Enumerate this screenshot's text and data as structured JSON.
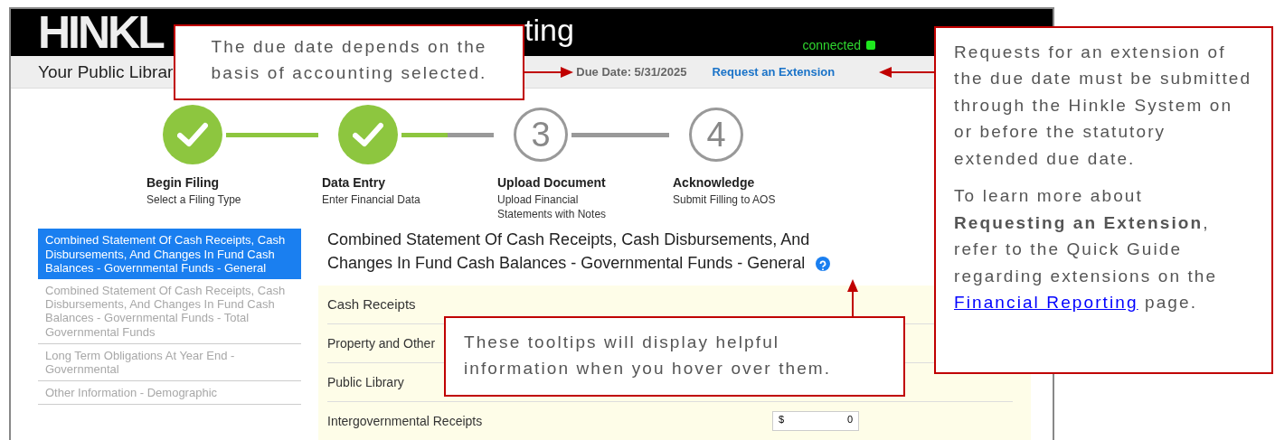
{
  "header": {
    "logo": "HINKL",
    "title": "ting",
    "status": "connected"
  },
  "subheader": {
    "library": "Your Public Librar",
    "due_date": "Due Date: 5/31/2025",
    "extension_link": "Request an Extension"
  },
  "steps": [
    {
      "title": "Begin Filing",
      "subtitle": "Select a Filing Type",
      "done": true
    },
    {
      "title": "Data Entry",
      "subtitle": "Enter Financial Data",
      "done": true
    },
    {
      "number": "3",
      "title": "Upload Document",
      "subtitle": "Upload Financial Statements with Notes",
      "done": false
    },
    {
      "number": "4",
      "title": "Acknowledge",
      "subtitle": "Submit Filling to AOS",
      "done": false
    }
  ],
  "sidebar": {
    "items": [
      {
        "label": "Combined Statement Of Cash Receipts, Cash Disbursements, And Changes In Fund Cash Balances - Governmental Funds - General",
        "selected": true,
        "disabled": false
      },
      {
        "label": "Combined Statement Of Cash Receipts, Cash Disbursements, And Changes In Fund Cash Balances - Governmental Funds - Total Governmental Funds",
        "selected": false,
        "disabled": true
      },
      {
        "label": "Long Term Obligations At Year End - Governmental",
        "selected": false,
        "disabled": true
      },
      {
        "label": "Other Information - Demographic",
        "selected": false,
        "disabled": true
      }
    ]
  },
  "section": {
    "title": "Combined Statement Of Cash Receipts, Cash Disbursements, And Changes In Fund Cash Balances - Governmental Funds - General",
    "rows": [
      {
        "kind": "header",
        "label": "Cash Receipts"
      },
      {
        "kind": "row",
        "label": "Property and Other"
      },
      {
        "kind": "row",
        "label": "Public Library"
      },
      {
        "kind": "input",
        "label": "Intergovernmental Receipts",
        "currency": "$",
        "value": "0"
      }
    ]
  },
  "callouts": [
    {
      "kind": "due",
      "paragraphs": [
        {
          "text": "The due date depends on the basis of accounting selected."
        }
      ]
    },
    {
      "kind": "extension",
      "paragraphs": [
        {
          "text": "Requests for an extension of the due date must be submitted through the Hinkle System on or before the statutory extended due date."
        },
        {
          "text": "To learn more about **Requesting an Extension**, refer to the Quick Guide regarding extensions on the",
          "link": "Financial Reporting",
          "after": "page."
        }
      ]
    },
    {
      "kind": "tooltip",
      "paragraphs": [
        {
          "text": "These tooltips will display helpful information when you hover over them."
        }
      ]
    }
  ]
}
